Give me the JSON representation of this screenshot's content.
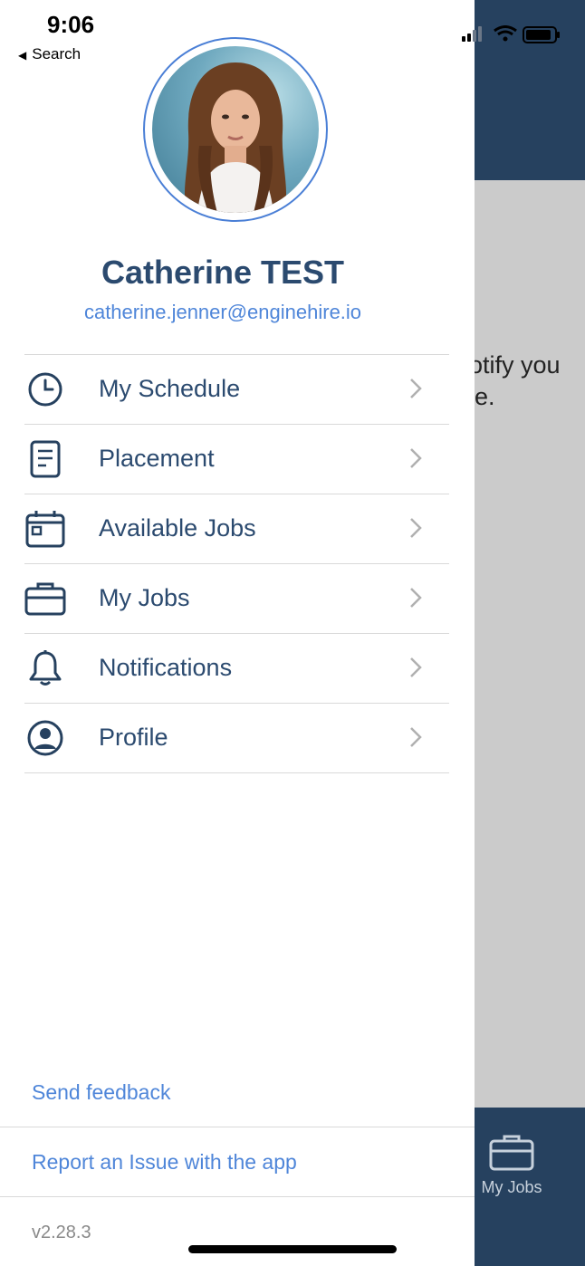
{
  "status_bar": {
    "time": "9:06",
    "back_label": "Search"
  },
  "user": {
    "name": "Catherine TEST",
    "email": "catherine.jenner@enginehire.io"
  },
  "menu": [
    {
      "label": "My Schedule",
      "icon": "clock-icon"
    },
    {
      "label": "Placement",
      "icon": "document-icon"
    },
    {
      "label": "Available Jobs",
      "icon": "calendar-icon"
    },
    {
      "label": "My Jobs",
      "icon": "briefcase-icon"
    },
    {
      "label": "Notifications",
      "icon": "bell-icon"
    },
    {
      "label": "Profile",
      "icon": "user-circle-icon"
    }
  ],
  "footer": {
    "send_feedback": "Send feedback",
    "report_issue": "Report an Issue with the app",
    "version": "v2.28.3"
  },
  "background_app": {
    "text_line1": "otify you",
    "text_line2": "le.",
    "tab_label": "My Jobs"
  },
  "colors": {
    "primary_navy": "#26415f",
    "text_navy": "#2b4a6f",
    "link_blue": "#4f86d9",
    "overlay_gray": "#cbcbcb"
  }
}
